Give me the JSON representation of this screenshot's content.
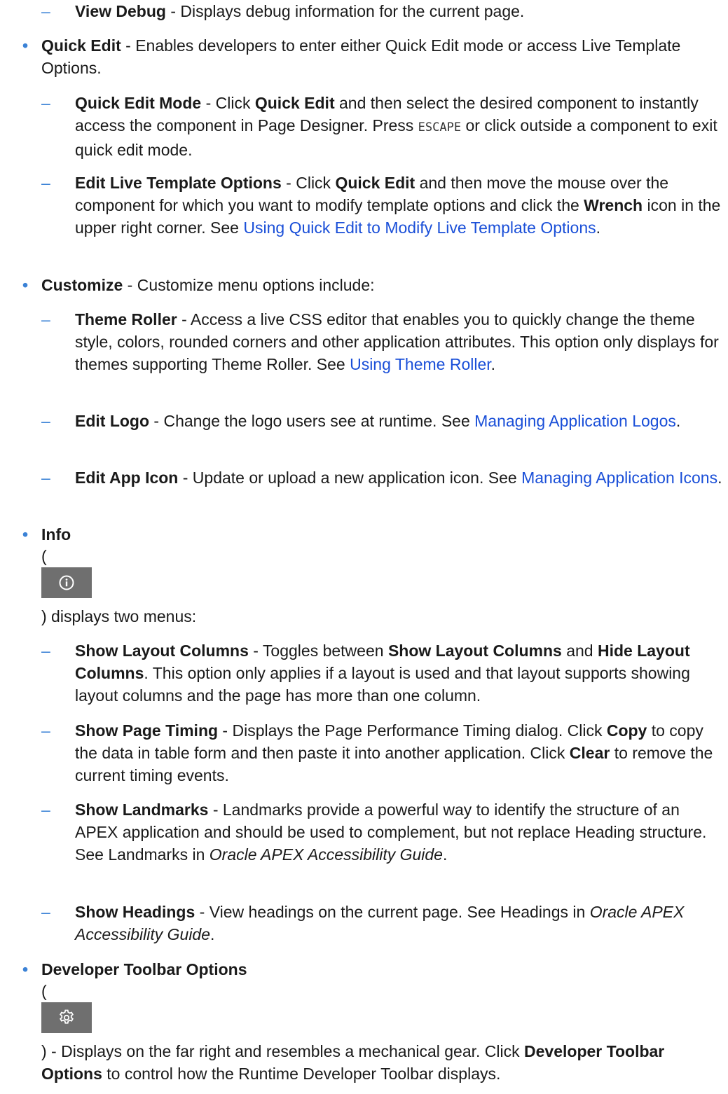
{
  "colors": {
    "bullet": "#3b82d6",
    "link": "#1a4fd8",
    "icon_bg": "#6f6f6f"
  },
  "view_debug": {
    "label": "View Debug",
    "text": " - Displays debug information for the current page."
  },
  "quick_edit": {
    "label": "Quick Edit",
    "text": " - Enables developers to enter either Quick Edit mode or access Live Template Options.",
    "mode": {
      "label": "Quick Edit Mode",
      "t1": " - Click ",
      "b1": "Quick Edit",
      "t2": " and then select the desired component to instantly access the component in Page Designer. Press ",
      "code": "ESCAPE",
      "t3": " or click outside a component to exit quick edit mode."
    },
    "live": {
      "label": "Edit Live Template Options",
      "t1": " - Click ",
      "b1": "Quick Edit",
      "t2": " and then move the mouse over the component for which you want to modify template options and click the ",
      "b2": "Wrench",
      "t3": " icon in the upper right corner. See ",
      "link": "Using Quick Edit to Modify Live Template Options",
      "t4": "."
    }
  },
  "customize": {
    "label": "Customize",
    "text": " - Customize menu options include:",
    "theme_roller": {
      "label": "Theme Roller",
      "text": " - Access a live CSS editor that enables you to quickly change the theme style, colors, rounded corners and other application attributes. This option only displays for themes supporting Theme Roller. See ",
      "link": "Using Theme Roller",
      "end": "."
    },
    "edit_logo": {
      "label": "Edit Logo",
      "text": " - Change the logo users see at runtime. See ",
      "link": "Managing Application Logos",
      "end": "."
    },
    "edit_app_icon": {
      "label": "Edit App Icon",
      "text": " - Update or upload a new application icon. See ",
      "link": "Managing Application Icons",
      "end": "."
    }
  },
  "info": {
    "label": "Info",
    "open_paren": "(",
    "icon": "info-icon",
    "after": ") displays two menus:",
    "layout_cols": {
      "label": "Show Layout Columns",
      "t1": " - Toggles between ",
      "b1": "Show Layout Columns",
      "t2": " and ",
      "b2": "Hide Layout Columns",
      "t3": ". This option only applies if a layout is used and that layout supports showing layout columns and the page has more than one column."
    },
    "page_timing": {
      "label": "Show Page Timing",
      "t1": " - Displays the Page Performance Timing dialog. Click ",
      "b1": "Copy",
      "t2": " to copy the data in table form and then paste it into another application. Click ",
      "b2": "Clear",
      "t3": " to remove the current timing events."
    },
    "landmarks": {
      "label": "Show Landmarks",
      "t1": " - Landmarks provide a powerful way to identify the structure of an APEX application and should be used to complement, but not replace Heading structure. See Landmarks in ",
      "i1": "Oracle APEX Accessibility Guide",
      "t2": "."
    },
    "headings": {
      "label": "Show Headings",
      "t1": " - View headings on the current page. See Headings in ",
      "i1": "Oracle APEX Accessibility Guide",
      "t2": "."
    }
  },
  "dev_toolbar_options": {
    "label": "Developer Toolbar Options",
    "open_paren": "(",
    "icon": "gear-icon",
    "t1": ") - Displays on the far right and resembles a mechanical gear. Click ",
    "b1": "Developer Toolbar Options",
    "t2": " to control how the Runtime Developer Toolbar displays."
  }
}
